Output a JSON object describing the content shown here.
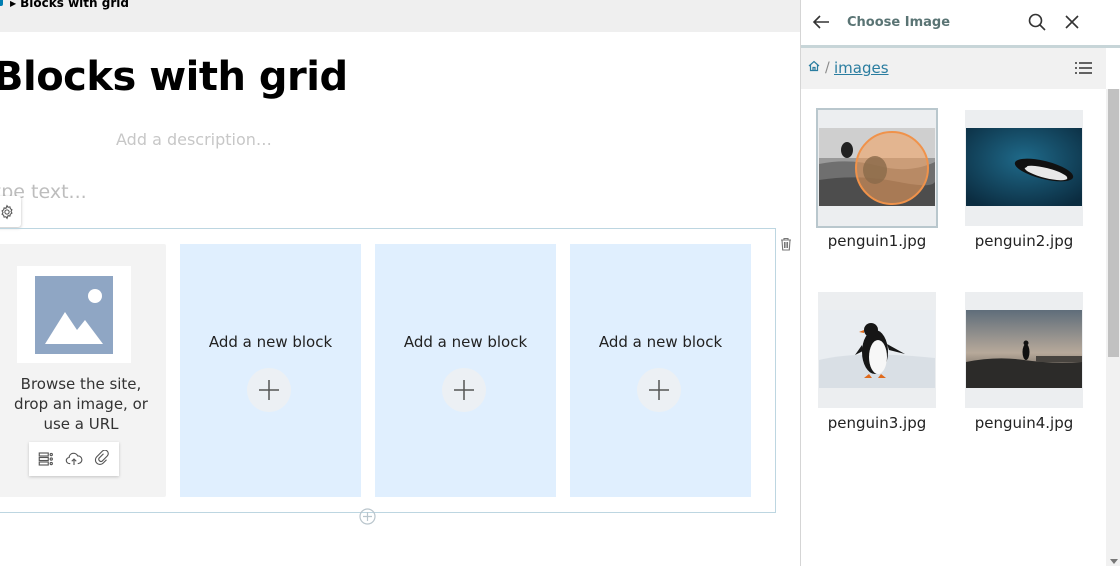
{
  "breadcrumb": {
    "current": "Blocks with grid"
  },
  "page": {
    "title": "Blocks with grid",
    "description_placeholder": "Add a description…",
    "text_placeholder": "ype text..."
  },
  "grid": {
    "image_cell": {
      "browse_text": "Browse the site, drop an image, or use a URL"
    },
    "add_cells": [
      {
        "label": "Add a new block"
      },
      {
        "label": "Add a new block"
      },
      {
        "label": "Add a new block"
      }
    ]
  },
  "sidebar": {
    "title": "Choose Image",
    "path_separator": "/",
    "path_link": "images",
    "items": [
      {
        "name": "penguin1.jpg",
        "selected": true
      },
      {
        "name": "penguin2.jpg",
        "selected": false
      },
      {
        "name": "penguin3.jpg",
        "selected": false
      },
      {
        "name": "penguin4.jpg",
        "selected": false
      }
    ]
  },
  "colors": {
    "accent": "#007eb1",
    "grid_cell": "#e0effe",
    "sidebar_title": "#5a7474",
    "link": "#2a7da0",
    "selection_ring": "#f4a15c"
  }
}
